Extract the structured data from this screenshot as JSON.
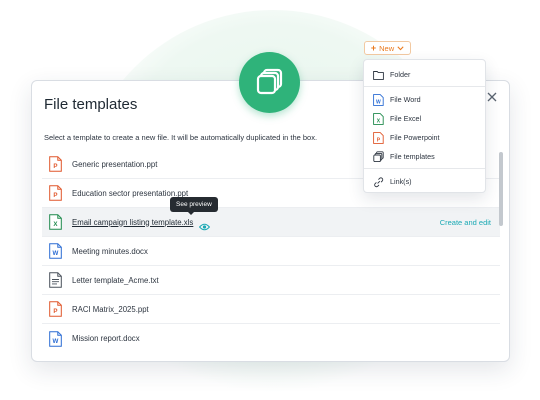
{
  "new_button": {
    "label": "New"
  },
  "new_menu": {
    "items": [
      {
        "label": "Folder",
        "icon": "folder-icon"
      },
      {
        "label": "File Word",
        "icon": "word-file-icon"
      },
      {
        "label": "File Excel",
        "icon": "excel-file-icon"
      },
      {
        "label": "File Powerpoint",
        "icon": "powerpoint-file-icon"
      },
      {
        "label": "File templates",
        "icon": "templates-icon"
      },
      {
        "label": "Link(s)",
        "icon": "link-icon"
      }
    ]
  },
  "dialog": {
    "title": "File templates",
    "subtitle": "Select a template to create a new file. It will be automatically duplicated in the box.",
    "tooltip": "See preview",
    "row_action": "Create and edit",
    "files": [
      {
        "name": "Generic presentation.ppt",
        "type": "ppt"
      },
      {
        "name": "Education sector presentation.ppt",
        "type": "ppt"
      },
      {
        "name": "Email campaign listing template.xls",
        "type": "xls",
        "hovered": true
      },
      {
        "name": "Meeting minutes.docx",
        "type": "docx"
      },
      {
        "name": "Letter template_Acme.txt",
        "type": "txt"
      },
      {
        "name": "RACI Matrix_2025.ppt",
        "type": "ppt"
      },
      {
        "name": "Mission report.docx",
        "type": "docx"
      }
    ]
  },
  "colors": {
    "accent_green": "#2fb37a",
    "accent_orange": "#ea7a1e",
    "accent_teal": "#1aa9b4",
    "word_blue": "#2b6cd4",
    "excel_green": "#1f8a4c",
    "ppt_orange": "#e0572b"
  }
}
